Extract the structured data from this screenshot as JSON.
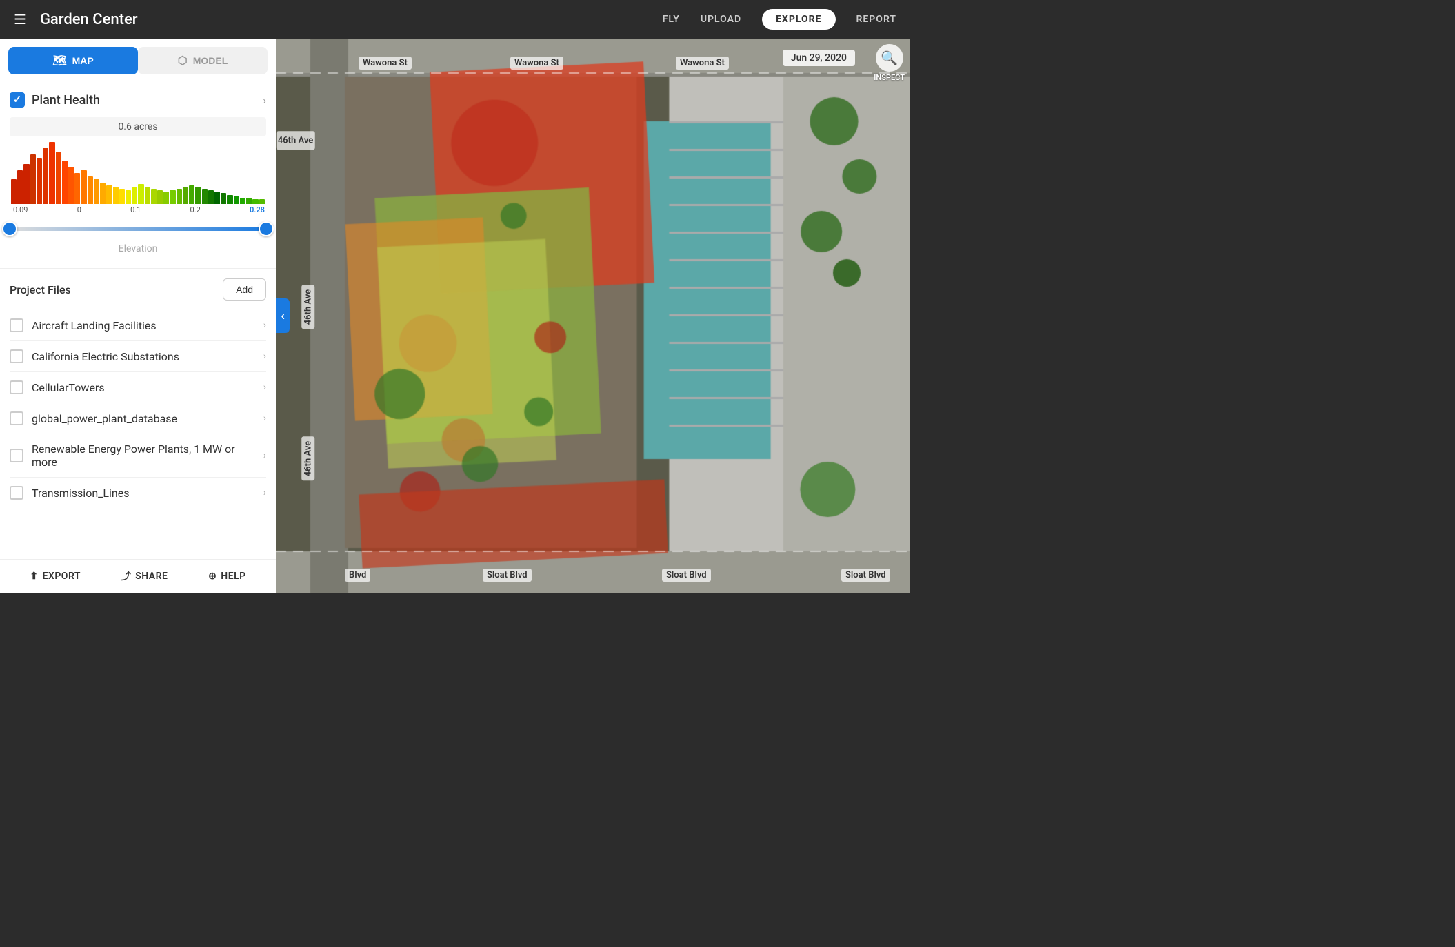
{
  "header": {
    "menu_icon": "☰",
    "title": "Garden Center",
    "nav": [
      {
        "id": "fly",
        "label": "FLY",
        "active": false
      },
      {
        "id": "upload",
        "label": "UPLOAD",
        "active": false
      },
      {
        "id": "explore",
        "label": "EXPLORE",
        "active": true
      },
      {
        "id": "report",
        "label": "REPORT",
        "active": false
      }
    ]
  },
  "sidebar": {
    "view_toggle": {
      "map_label": "MAP",
      "model_label": "MODEL"
    },
    "plant_health": {
      "label": "Plant Health",
      "checked": true,
      "acres": "0.6 acres",
      "range_min": "-0.09",
      "range_zero": "0",
      "range_01": "0.1",
      "range_02": "0.2",
      "range_max": "0.28"
    },
    "elevation_label": "Elevation",
    "project_files": {
      "title": "Project Files",
      "add_label": "Add",
      "items": [
        {
          "id": "aircraft",
          "name": "Aircraft Landing Facilities",
          "checked": false
        },
        {
          "id": "ca-electric",
          "name": "California Electric Substations",
          "checked": false
        },
        {
          "id": "cellular",
          "name": "CellularTowers",
          "checked": false
        },
        {
          "id": "power-plant",
          "name": "global_power_plant_database",
          "checked": false
        },
        {
          "id": "renewable",
          "name": "Renewable Energy Power Plants, 1 MW or more",
          "checked": false
        },
        {
          "id": "transmission",
          "name": "Transmission_Lines",
          "checked": false
        }
      ]
    },
    "footer": {
      "export": "EXPORT",
      "share": "SHARE",
      "help": "HELP"
    }
  },
  "map": {
    "date": "Jun 29, 2020",
    "inspect_label": "INSPECT",
    "road_labels": [
      {
        "id": "wawona1",
        "text": "Wawona St"
      },
      {
        "id": "wawona2",
        "text": "Wawona St"
      },
      {
        "id": "wawona3",
        "text": "Wawona St"
      },
      {
        "id": "46th1",
        "text": "46th Ave"
      },
      {
        "id": "46th2",
        "text": "46th Ave"
      },
      {
        "id": "46th3",
        "text": "46th Ave"
      },
      {
        "id": "sloat1",
        "text": "Sloat Blvd"
      },
      {
        "id": "sloat2",
        "text": "Sloat Blvd"
      },
      {
        "id": "sloat3",
        "text": "Sloat Blvd"
      },
      {
        "id": "blvd",
        "text": "Blvd"
      }
    ]
  },
  "colors": {
    "accent_blue": "#1a7ae0",
    "header_bg": "#2c2c2c",
    "sidebar_bg": "#ffffff"
  }
}
